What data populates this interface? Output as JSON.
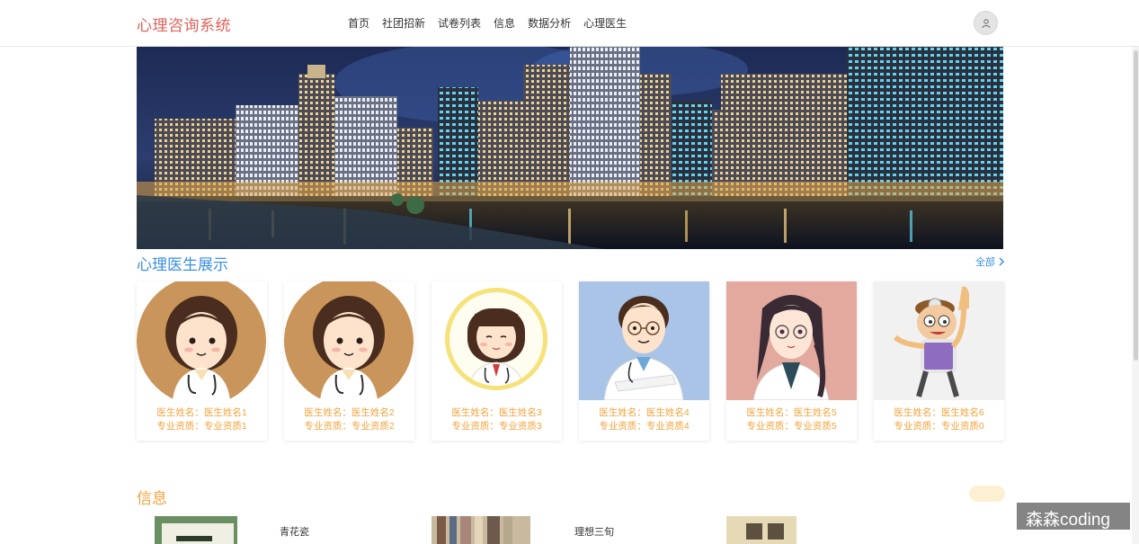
{
  "app": {
    "title": "心理咨询系统"
  },
  "nav": {
    "items": [
      {
        "label": "首页"
      },
      {
        "label": "社团招新"
      },
      {
        "label": "试卷列表"
      },
      {
        "label": "信息"
      },
      {
        "label": "数据分析"
      },
      {
        "label": "心理医生"
      }
    ]
  },
  "doctors_section": {
    "title": "心理医生展示",
    "view_all": "全部",
    "cards": [
      {
        "name_line": "医生姓名：医生姓名1",
        "qual_line": "专业资质：专业资质1"
      },
      {
        "name_line": "医生姓名：医生姓名2",
        "qual_line": "专业资质：专业资质2"
      },
      {
        "name_line": "医生姓名：医生姓名3",
        "qual_line": "专业资质：专业资质3"
      },
      {
        "name_line": "医生姓名：医生姓名4",
        "qual_line": "专业资质：专业资质4"
      },
      {
        "name_line": "医生姓名：医生姓名5",
        "qual_line": "专业资质：专业资质5"
      },
      {
        "name_line": "医生姓名：医生姓名6",
        "qual_line": "专业资质：专业资质0"
      }
    ]
  },
  "info_section": {
    "title": "信息",
    "items": [
      {
        "title": "青花瓷"
      },
      {
        "title": "理想三旬"
      }
    ]
  },
  "watermark": "森森coding",
  "colors": {
    "brand": "#e0625a",
    "accent_blue": "#3a8ee6",
    "accent_orange": "#f3a33b"
  }
}
